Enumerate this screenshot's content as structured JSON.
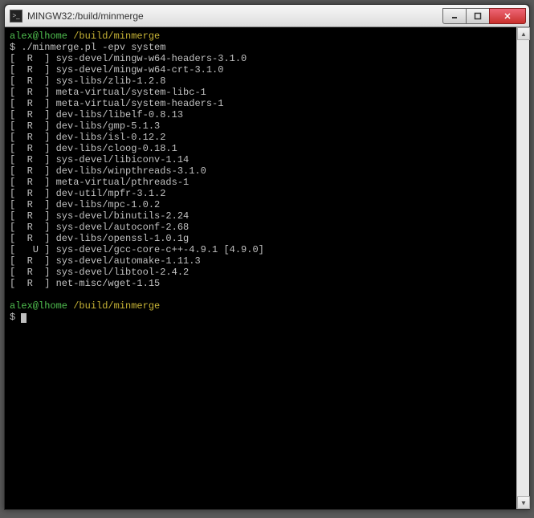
{
  "window": {
    "title": "MINGW32:/build/minmerge"
  },
  "prompt": {
    "user": "alex@lhome",
    "path": "/build/minmerge",
    "symbol": "$"
  },
  "command": "./minmerge.pl -epv system",
  "packages": [
    {
      "flags": "[  R  ]",
      "atom": "sys-devel/mingw-w64-headers-3.1.0",
      "extra": ""
    },
    {
      "flags": "[  R  ]",
      "atom": "sys-devel/mingw-w64-crt-3.1.0",
      "extra": ""
    },
    {
      "flags": "[  R  ]",
      "atom": "sys-libs/zlib-1.2.8",
      "extra": ""
    },
    {
      "flags": "[  R  ]",
      "atom": "meta-virtual/system-libc-1",
      "extra": ""
    },
    {
      "flags": "[  R  ]",
      "atom": "meta-virtual/system-headers-1",
      "extra": ""
    },
    {
      "flags": "[  R  ]",
      "atom": "dev-libs/libelf-0.8.13",
      "extra": ""
    },
    {
      "flags": "[  R  ]",
      "atom": "dev-libs/gmp-5.1.3",
      "extra": ""
    },
    {
      "flags": "[  R  ]",
      "atom": "dev-libs/isl-0.12.2",
      "extra": ""
    },
    {
      "flags": "[  R  ]",
      "atom": "dev-libs/cloog-0.18.1",
      "extra": ""
    },
    {
      "flags": "[  R  ]",
      "atom": "sys-devel/libiconv-1.14",
      "extra": ""
    },
    {
      "flags": "[  R  ]",
      "atom": "dev-libs/winpthreads-3.1.0",
      "extra": ""
    },
    {
      "flags": "[  R  ]",
      "atom": "meta-virtual/pthreads-1",
      "extra": ""
    },
    {
      "flags": "[  R  ]",
      "atom": "dev-util/mpfr-3.1.2",
      "extra": ""
    },
    {
      "flags": "[  R  ]",
      "atom": "dev-libs/mpc-1.0.2",
      "extra": ""
    },
    {
      "flags": "[  R  ]",
      "atom": "sys-devel/binutils-2.24",
      "extra": ""
    },
    {
      "flags": "[  R  ]",
      "atom": "sys-devel/autoconf-2.68",
      "extra": ""
    },
    {
      "flags": "[  R  ]",
      "atom": "dev-libs/openssl-1.0.1g",
      "extra": ""
    },
    {
      "flags": "[   U ]",
      "atom": "sys-devel/gcc-core-c++-4.9.1",
      "extra": "[4.9.0]"
    },
    {
      "flags": "[  R  ]",
      "atom": "sys-devel/automake-1.11.3",
      "extra": ""
    },
    {
      "flags": "[  R  ]",
      "atom": "sys-devel/libtool-2.4.2",
      "extra": ""
    },
    {
      "flags": "[  R  ]",
      "atom": "net-misc/wget-1.15",
      "extra": ""
    }
  ]
}
